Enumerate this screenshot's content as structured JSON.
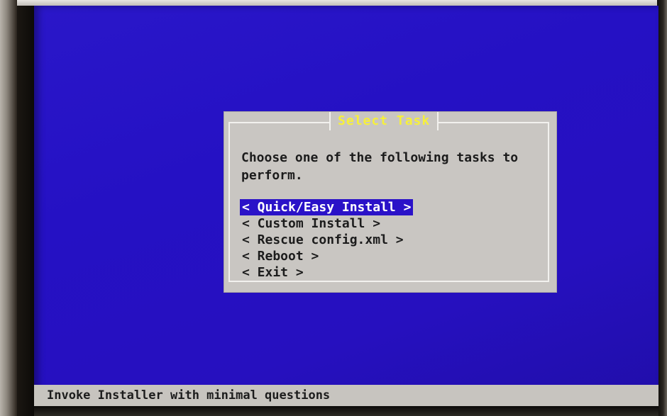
{
  "dialog": {
    "title": "Select Task",
    "prompt": "Choose one of the following tasks to\nperform.",
    "items": [
      {
        "label": "< Quick/Easy Install >",
        "selected": true
      },
      {
        "label": "< Custom Install >",
        "selected": false
      },
      {
        "label": "< Rescue config.xml >",
        "selected": false
      },
      {
        "label": "< Reboot >",
        "selected": false
      },
      {
        "label": "< Exit >",
        "selected": false
      }
    ]
  },
  "status_bar": {
    "text": "Invoke Installer with minimal questions"
  },
  "colors": {
    "background": "#2511c4",
    "dialog": "#c9c6c2",
    "title": "#f6f03a",
    "highlight": "#2a12c8"
  }
}
